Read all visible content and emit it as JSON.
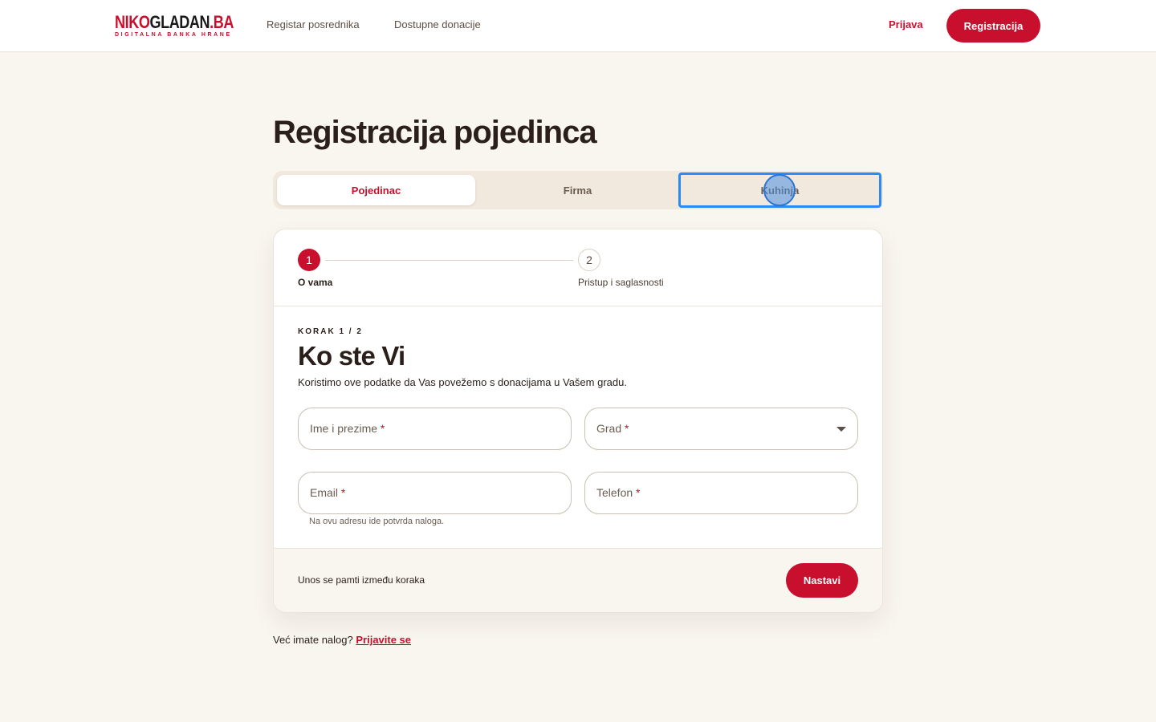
{
  "header": {
    "logo": {
      "part1": "NIKO",
      "part2": "GLADAN",
      "part3": ".BA",
      "tagline": "DIGITALNA BANKA HRANE"
    },
    "nav": [
      "Registar posrednika",
      "Dostupne donacije"
    ],
    "login": "Prijava",
    "register": "Registracija"
  },
  "page_title": "Registracija pojedinca",
  "tabs": [
    "Pojedinac",
    "Firma",
    "Kuhinja"
  ],
  "stepper": {
    "steps": [
      {
        "number": "1",
        "label": "O vama"
      },
      {
        "number": "2",
        "label": "Pristup i saglasnosti"
      }
    ]
  },
  "form": {
    "kicker": "KORAK 1 / 2",
    "title": "Ko ste Vi",
    "description": "Koristimo ove podatke da Vas povežemo s donacijama u Vašem gradu.",
    "fields": {
      "name": "Ime i prezime",
      "city": "Grad",
      "email": "Email",
      "phone": "Telefon"
    },
    "required_mark": "*",
    "email_hint": "Na ovu adresu ide potvrda naloga."
  },
  "footer": {
    "note": "Unos se pamti između koraka",
    "next": "Nastavi"
  },
  "bottom": {
    "text": "Već imate nalog?",
    "link": "Prijavite se"
  },
  "colors": {
    "accent": "#c8102e",
    "background": "#f9f5ef",
    "focus": "#2b8af7"
  }
}
